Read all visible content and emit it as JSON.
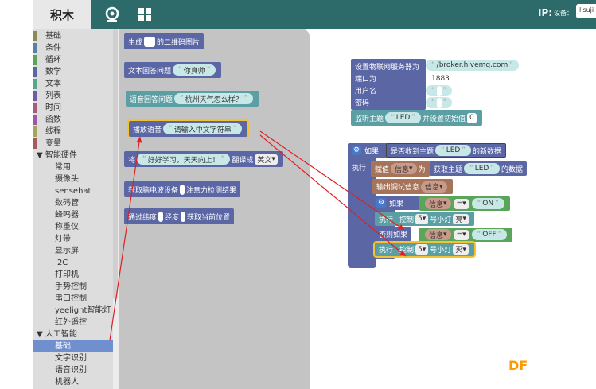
{
  "header": {
    "logo": "积木",
    "ip_label": "IP:",
    "device_label": "设备：",
    "ip_value": "lisuji"
  },
  "categories": [
    {
      "label": "基础",
      "color": "#8a8a5b"
    },
    {
      "label": "条件",
      "color": "#5b80a5"
    },
    {
      "label": "循环",
      "color": "#5ba55b"
    },
    {
      "label": "数学",
      "color": "#5b67a5"
    },
    {
      "label": "文本",
      "color": "#5ba58c"
    },
    {
      "label": "列表",
      "color": "#745ba5"
    },
    {
      "label": "时间",
      "color": "#a55b80"
    },
    {
      "label": "函数",
      "color": "#995ba5"
    },
    {
      "label": "线程",
      "color": "#a5a55b"
    },
    {
      "label": "变量",
      "color": "#a55b5b"
    }
  ],
  "hardware_section": "▼ 智能硬件",
  "hardware_items": [
    "常用",
    "摄像头",
    "sensehat",
    "数码管",
    "蜂鸣器",
    "称重仪",
    "灯带",
    "显示屏",
    "I2C",
    "打印机",
    "手势控制",
    "串口控制",
    "yeelight智能灯",
    "红外遥控"
  ],
  "ai_section": "▼ 人工智能",
  "ai_items": [
    "基础",
    "文字识别",
    "语音识别",
    "机器人"
  ],
  "flyout": {
    "b1": {
      "label": "生成",
      "tail": "的二维码图片"
    },
    "b2": {
      "label": "文本回答问题",
      "value": "你真帅"
    },
    "b3": {
      "label": "语音回答问题",
      "value": "杭州天气怎么样？"
    },
    "b4": {
      "label": "播放语音",
      "value": "请输入中文字符串"
    },
    "b5": {
      "label": "将",
      "value": "好好学习，天天向上！",
      "mid": "翻译成",
      "lang": "英文"
    },
    "b6": {
      "label": "获取脑电波设备",
      "tail": "注意力检测结果"
    },
    "b7": {
      "label": "通过纬度",
      "mid": "经度",
      "tail": "获取当前位置"
    }
  },
  "workspace": {
    "setup": {
      "server_label": "设置物联网服务器为",
      "server": "/broker.hivemq.com",
      "port_label": "端口为",
      "port": "1883",
      "user_label": "用户名",
      "pass_label": "密码"
    },
    "listen": {
      "label": "监听主题",
      "topic": "LED",
      "tail": "并设置初始值",
      "init": "0"
    },
    "if_label": "如果",
    "cond_label": "是否收到主题",
    "cond_topic": "LED",
    "cond_tail": "的新数据",
    "do_label": "执行",
    "assign": {
      "label": "赋值",
      "var": "信息",
      "mid": "为",
      "get": "获取主题",
      "topic": "LED",
      "tail": "的数据"
    },
    "debug": {
      "label": "输出调试信息",
      "var": "信息"
    },
    "if2": {
      "label": "如果",
      "var": "信息",
      "op": "=",
      "val": "ON"
    },
    "ctl1": {
      "do": "执行",
      "label": "控制",
      "num": "5",
      "mid": "号小灯",
      "state": "亮"
    },
    "elseif": {
      "label": "否则如果",
      "var": "信息",
      "op": "=",
      "val": "OFF"
    },
    "ctl2": {
      "do": "执行",
      "label": "控制",
      "num": "5",
      "mid": "号小灯",
      "state": "灭"
    }
  },
  "watermark": "DF",
  "colors": {
    "topbar": "#2d6b6b",
    "selected": "#6f8fcf",
    "highlight": "#f2c232",
    "arrow": "#e02020"
  }
}
